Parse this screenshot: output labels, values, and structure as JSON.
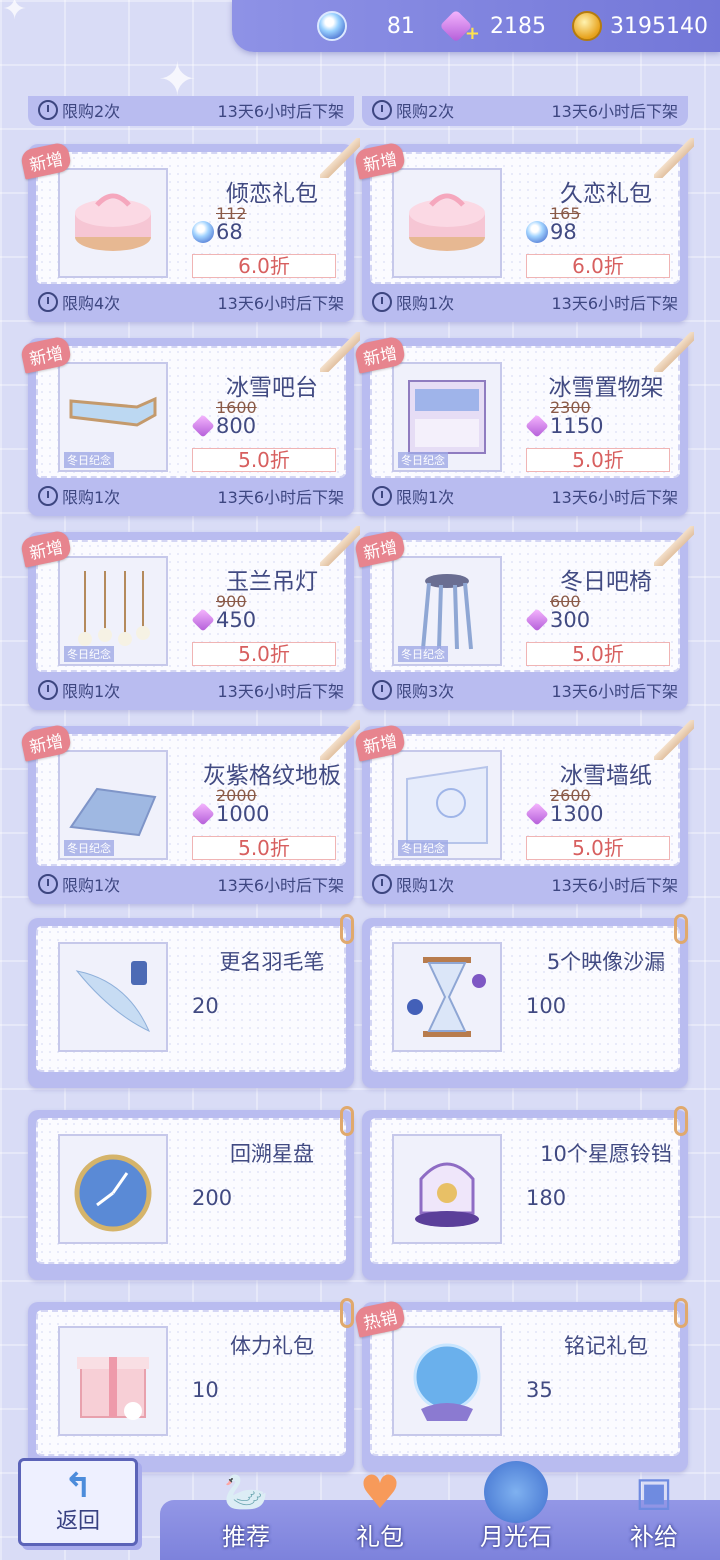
{
  "currency": {
    "diamond": "81",
    "crystal": "2185",
    "gold": "3195140"
  },
  "partial_row": [
    {
      "limit": "限购2次",
      "time": "13天6小时后下架"
    },
    {
      "limit": "限购2次",
      "time": "13天6小时后下架"
    }
  ],
  "items": [
    {
      "name": "倾恋礼包",
      "badge": "新增",
      "old_price": "112",
      "price": "68",
      "currency": "diamond",
      "discount": "6.0折",
      "limit": "限购4次",
      "time": "13天6小时后下架",
      "icon": "cake-box-icon",
      "tag": ""
    },
    {
      "name": "久恋礼包",
      "badge": "新增",
      "old_price": "165",
      "price": "98",
      "currency": "diamond",
      "discount": "6.0折",
      "limit": "限购1次",
      "time": "13天6小时后下架",
      "icon": "cake-box-icon",
      "tag": ""
    },
    {
      "name": "冰雪吧台",
      "badge": "新增",
      "old_price": "1600",
      "price": "800",
      "currency": "crystal",
      "discount": "5.0折",
      "limit": "限购1次",
      "time": "13天6小时后下架",
      "icon": "bar-counter-icon",
      "tag": "冬日纪念"
    },
    {
      "name": "冰雪置物架",
      "badge": "新增",
      "old_price": "2300",
      "price": "1150",
      "currency": "crystal",
      "discount": "5.0折",
      "limit": "限购1次",
      "time": "13天6小时后下架",
      "icon": "shelf-icon",
      "tag": "冬日纪念"
    },
    {
      "name": "玉兰吊灯",
      "badge": "新增",
      "old_price": "900",
      "price": "450",
      "currency": "crystal",
      "discount": "5.0折",
      "limit": "限购1次",
      "time": "13天6小时后下架",
      "icon": "pendant-lamp-icon",
      "tag": "冬日纪念"
    },
    {
      "name": "冬日吧椅",
      "badge": "新增",
      "old_price": "600",
      "price": "300",
      "currency": "crystal",
      "discount": "5.0折",
      "limit": "限购3次",
      "time": "13天6小时后下架",
      "icon": "bar-stool-icon",
      "tag": "冬日纪念"
    },
    {
      "name": "灰紫格纹地板",
      "badge": "新增",
      "old_price": "2000",
      "price": "1000",
      "currency": "crystal",
      "discount": "5.0折",
      "limit": "限购1次",
      "time": "13天6小时后下架",
      "icon": "floor-tile-icon",
      "tag": "冬日纪念"
    },
    {
      "name": "冰雪墙纸",
      "badge": "新增",
      "old_price": "2600",
      "price": "1300",
      "currency": "crystal",
      "discount": "5.0折",
      "limit": "限购1次",
      "time": "13天6小时后下架",
      "icon": "wallpaper-icon",
      "tag": "冬日纪念"
    }
  ],
  "plain_items": [
    {
      "name": "更名羽毛笔",
      "price": "20",
      "currency": "crystal",
      "icon": "quill-pen-icon",
      "badge": ""
    },
    {
      "name": "5个映像沙漏",
      "price": "100",
      "currency": "crystal",
      "icon": "hourglass-icon",
      "badge": ""
    },
    {
      "name": "回溯星盘",
      "price": "200",
      "currency": "crystal",
      "icon": "astrolabe-icon",
      "badge": ""
    },
    {
      "name": "10个星愿铃铛",
      "price": "180",
      "currency": "diamond",
      "icon": "birdcage-bell-icon",
      "badge": ""
    },
    {
      "name": "体力礼包",
      "price": "10",
      "currency": "diamond",
      "icon": "gift-box-icon",
      "badge": ""
    },
    {
      "name": "铭记礼包",
      "price": "35",
      "currency": "diamond",
      "icon": "crystal-ball-icon",
      "badge": "热销"
    }
  ],
  "nav": {
    "back": "返回",
    "tabs": [
      {
        "label": "推荐",
        "icon": "swan-icon"
      },
      {
        "label": "礼包",
        "icon": "hearts-icon",
        "active": true
      },
      {
        "label": "月光石",
        "icon": "moonstone-icon"
      },
      {
        "label": "补给",
        "icon": "shopping-bag-icon"
      }
    ]
  }
}
